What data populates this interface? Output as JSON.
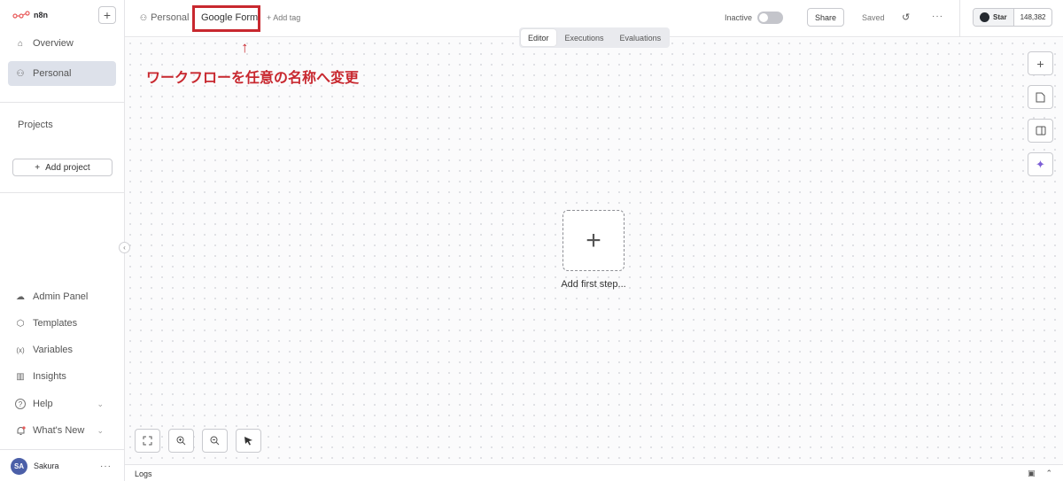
{
  "app": {
    "name": "n8n"
  },
  "sidebar": {
    "add_symbol": "+",
    "nav": [
      {
        "label": "Overview",
        "icon": "home-icon",
        "glyph": "⌂"
      },
      {
        "label": "Personal",
        "icon": "user-icon",
        "glyph": "⚇"
      }
    ],
    "projects_label": "Projects",
    "add_project_label": "Add project",
    "bottom_items": [
      {
        "label": "Admin Panel",
        "icon": "cloud-icon",
        "glyph": "☁"
      },
      {
        "label": "Templates",
        "icon": "box-icon",
        "glyph": "⬡"
      },
      {
        "label": "Variables",
        "icon": "variables-icon",
        "glyph": "(x)"
      },
      {
        "label": "Insights",
        "icon": "chart-icon",
        "glyph": "▥"
      },
      {
        "label": "Help",
        "icon": "help-icon",
        "glyph": "?"
      },
      {
        "label": "What's New",
        "icon": "bell-icon",
        "glyph": "♪"
      }
    ],
    "user": {
      "initials": "SA",
      "name": "Sakura"
    }
  },
  "header": {
    "breadcrumb_project": "Personal",
    "workflow_name": "Google Form",
    "add_tag_label": "+ Add tag",
    "active_status_label": "Inactive",
    "share_label": "Share",
    "save_status": "Saved",
    "github": {
      "star_label": "Star",
      "star_count": "148,382"
    }
  },
  "tabs": [
    {
      "label": "Editor",
      "active": true
    },
    {
      "label": "Executions",
      "active": false
    },
    {
      "label": "Evaluations",
      "active": false
    }
  ],
  "annotation": {
    "arrow": "↑",
    "text": "ワークフローを任意の名称へ変更",
    "color": "#c8282f"
  },
  "canvas": {
    "first_step_label": "Add first step..."
  },
  "logs": {
    "label": "Logs"
  }
}
